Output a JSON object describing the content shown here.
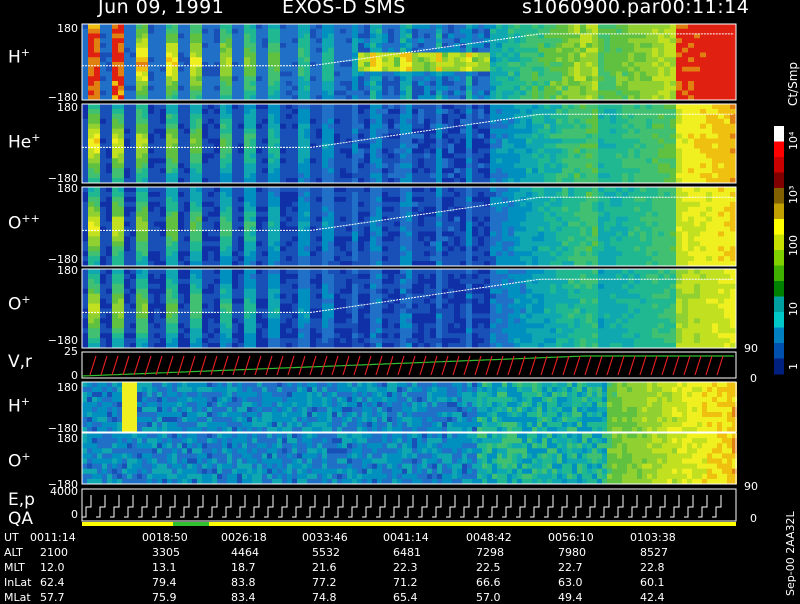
{
  "header": {
    "date": "Jun 09, 1991",
    "mission": "EXOS-D SMS",
    "file": "s1060900.par",
    "time": "00:11:14"
  },
  "side_label": "Sep-00 2AA32L",
  "colorbar": {
    "unit": "Ct/Smp",
    "ticks": [
      "10⁴",
      "10³",
      "100",
      "10",
      "1"
    ],
    "colors": [
      "#ffffff",
      "#ff0000",
      "#c80000",
      "#800000",
      "#806000",
      "#c0a000",
      "#ffff00",
      "#c8e000",
      "#80d000",
      "#40b000",
      "#008000",
      "#00a0a0",
      "#00c8c8",
      "#0080c0",
      "#0050b0",
      "#002080"
    ]
  },
  "panels": [
    {
      "id": "h-plus-1",
      "species": "H",
      "charge": "+",
      "ytop": "180",
      "ybot": "−180"
    },
    {
      "id": "he-plus",
      "species": "He",
      "charge": "+",
      "ytop": "180",
      "ybot": "−180"
    },
    {
      "id": "o-pp",
      "species": "O",
      "charge": "++",
      "ytop": "180",
      "ybot": "−180"
    },
    {
      "id": "o-plus-1",
      "species": "O",
      "charge": "+",
      "ytop": "180",
      "ybot": "−180"
    },
    {
      "id": "h-plus-2",
      "species": "H",
      "charge": "+",
      "ytop": "180",
      "ybot": "−180"
    },
    {
      "id": "o-plus-2",
      "species": "O",
      "charge": "+",
      "ytop": "180",
      "ybot": "−180"
    }
  ],
  "vr_panel": {
    "label": "V,r",
    "ytop": "25",
    "ybot": "0",
    "right_top": "90",
    "right_bot": "0"
  },
  "o2_right": "90",
  "ep_panel": {
    "label1": "E,p",
    "label2": "QA",
    "ytop": "4000",
    "ybot": "0",
    "right_bot": "0"
  },
  "time_axis": {
    "rows": [
      {
        "name": "UT",
        "values": [
          "0011:14",
          "0018:50",
          "0026:18",
          "0033:46",
          "0041:14",
          "0048:42",
          "0056:10",
          "0103:38"
        ]
      },
      {
        "name": "ALT",
        "values": [
          "2100",
          "3305",
          "4464",
          "5532",
          "6481",
          "7298",
          "7980",
          "8527"
        ]
      },
      {
        "name": "MLT",
        "values": [
          "12.0",
          "13.1",
          "18.7",
          "21.6",
          "22.3",
          "22.5",
          "22.7",
          "22.8"
        ]
      },
      {
        "name": "InLat",
        "values": [
          "62.4",
          "79.4",
          "83.8",
          "77.2",
          "71.2",
          "66.6",
          "63.0",
          "60.1"
        ]
      },
      {
        "name": "MLat",
        "values": [
          "57.7",
          "75.9",
          "83.4",
          "74.8",
          "65.4",
          "57.0",
          "49.4",
          "42.4"
        ]
      }
    ]
  },
  "chart_data": {
    "type": "heatmap",
    "title": "Jun 09, 1991 EXOS-D SMS",
    "panels": [
      "H+",
      "He+",
      "O++",
      "O+",
      "V,r",
      "H+",
      "O+",
      "E,p QA"
    ],
    "y_range_pitch": [
      -180,
      180
    ],
    "vr_range": [
      0,
      25
    ],
    "ep_range": [
      0,
      4000
    ],
    "colorbar_unit": "Ct/Smp",
    "colorbar_ticks": [
      "1",
      "10",
      "100",
      "10³",
      "10⁴"
    ],
    "x_ticks_ut": [
      "0011:14",
      "0018:50",
      "0026:18",
      "0033:46",
      "0041:14",
      "0048:42",
      "0056:10",
      "0103:38"
    ]
  }
}
